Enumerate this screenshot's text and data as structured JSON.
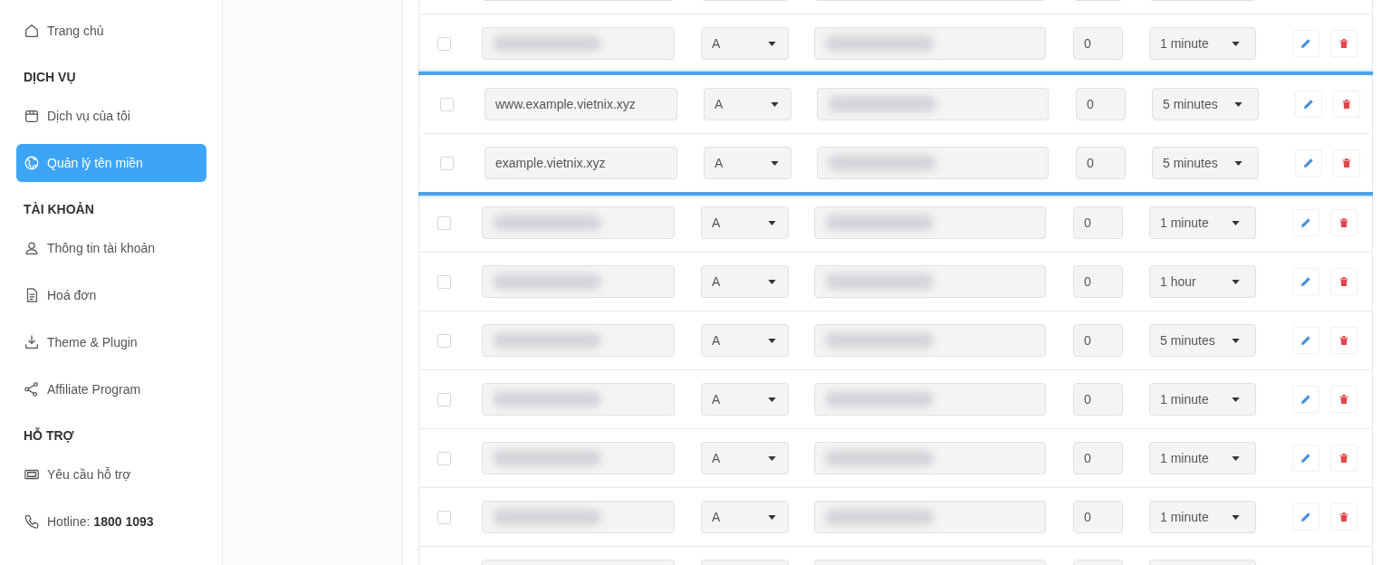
{
  "sidebar": {
    "items": [
      {
        "kind": "link",
        "label": "Trang chủ",
        "selected": false
      },
      {
        "kind": "heading",
        "label": "DỊCH VỤ"
      },
      {
        "kind": "link",
        "label": "Dịch vụ của tôi",
        "selected": false
      },
      {
        "kind": "link",
        "label": "Quản lý tên miền",
        "selected": true
      },
      {
        "kind": "heading",
        "label": "TÀI KHOẢN"
      },
      {
        "kind": "link",
        "label": "Thông tin tài khoản",
        "selected": false
      },
      {
        "kind": "link",
        "label": "Hoá đơn",
        "selected": false
      },
      {
        "kind": "link",
        "label": "Theme & Plugin",
        "selected": false
      },
      {
        "kind": "link",
        "label": "Affiliate Program",
        "selected": false
      },
      {
        "kind": "heading",
        "label": "HỖ TRỢ"
      },
      {
        "kind": "link",
        "label": "Yêu cầu hỗ trợ",
        "selected": false
      },
      {
        "kind": "link",
        "label": "Hotline: **1800 1093**",
        "selected": false
      }
    ]
  },
  "records": {
    "rows": [
      {
        "kind": "cut",
        "highlighted": false
      },
      {
        "kind": "record",
        "highlighted": false,
        "checked": false,
        "name_redacted": true,
        "type": "A",
        "value_redacted": true,
        "priority": "0",
        "ttl": "1 minute"
      },
      {
        "kind": "record",
        "highlighted": true,
        "checked": false,
        "name": "www.example.vietnix.xyz",
        "type": "A",
        "value_redacted": true,
        "priority": "0",
        "ttl": "5 minutes"
      },
      {
        "kind": "record",
        "highlighted": true,
        "checked": false,
        "name": "example.vietnix.xyz",
        "type": "A",
        "value_redacted": true,
        "priority": "0",
        "ttl": "5 minutes"
      },
      {
        "kind": "record",
        "highlighted": false,
        "checked": false,
        "name_redacted": true,
        "type": "A",
        "value_redacted": true,
        "priority": "0",
        "ttl": "1 minute"
      },
      {
        "kind": "record",
        "highlighted": false,
        "checked": false,
        "name_redacted": true,
        "type": "A",
        "value_redacted": true,
        "priority": "0",
        "ttl": "1 hour"
      },
      {
        "kind": "record",
        "highlighted": false,
        "checked": false,
        "name_redacted": true,
        "type": "A",
        "value_redacted": true,
        "priority": "0",
        "ttl": "5 minutes"
      },
      {
        "kind": "record",
        "highlighted": false,
        "checked": false,
        "name_redacted": true,
        "type": "A",
        "value_redacted": true,
        "priority": "0",
        "ttl": "1 minute"
      },
      {
        "kind": "record",
        "highlighted": false,
        "checked": false,
        "name_redacted": true,
        "type": "A",
        "value_redacted": true,
        "priority": "0",
        "ttl": "1 minute"
      },
      {
        "kind": "record",
        "highlighted": false,
        "checked": false,
        "name_redacted": true,
        "type": "A",
        "value_redacted": true,
        "priority": "0",
        "ttl": "1 minute"
      },
      {
        "kind": "cut",
        "highlighted": false
      }
    ]
  }
}
